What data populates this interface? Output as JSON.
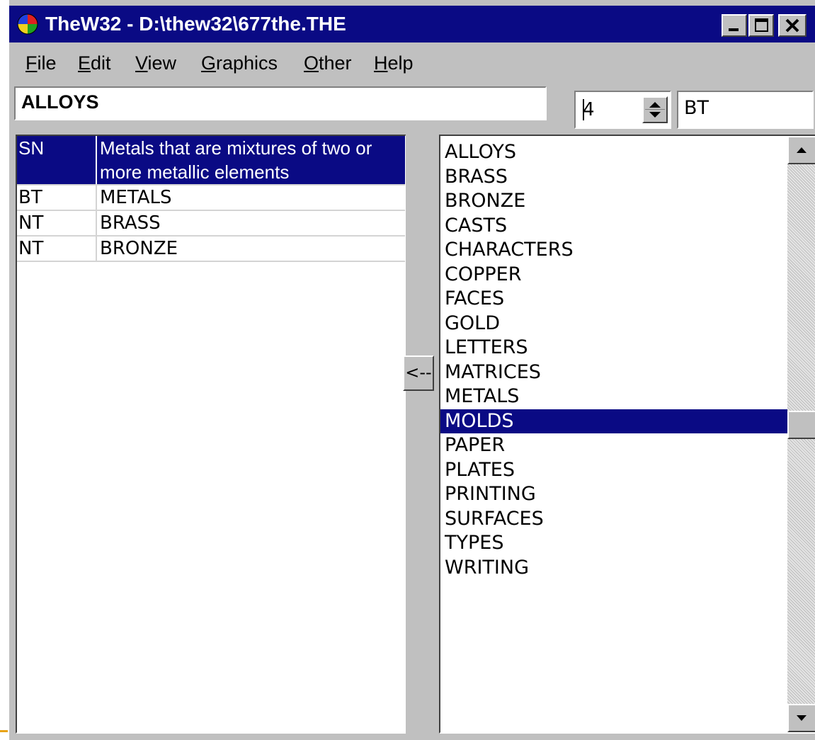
{
  "window": {
    "title": "TheW32 - D:\\thew32\\677the.THE",
    "icon": "globe-icon"
  },
  "menu": {
    "items": [
      "File",
      "Edit",
      "View",
      "Graphics",
      "Other",
      "Help"
    ]
  },
  "entry": {
    "term": "ALLOYS",
    "spin_value": "4",
    "relation_code": "BT"
  },
  "relations": {
    "rows": [
      {
        "code": "SN",
        "value": "Metals that are mixtures of two or more metallic elements",
        "selected": true
      },
      {
        "code": "BT",
        "value": "METALS",
        "selected": false
      },
      {
        "code": "NT",
        "value": "BRASS",
        "selected": false
      },
      {
        "code": "NT",
        "value": "BRONZE",
        "selected": false
      }
    ]
  },
  "transfer_button": {
    "label": "<--"
  },
  "term_list": {
    "items": [
      "ALLOYS",
      "BRASS",
      "BRONZE",
      "CASTS",
      "CHARACTERS",
      "COPPER",
      "FACES",
      "GOLD",
      "LETTERS",
      "MATRICES",
      "METALS",
      "MOLDS",
      "PAPER",
      "PLATES",
      "PRINTING",
      "SURFACES",
      "TYPES",
      "WRITING"
    ],
    "selected": "MOLDS"
  },
  "colors": {
    "titlebar": "#0a0a84",
    "selection": "#0a0a84",
    "face": "#c0c0c0"
  }
}
